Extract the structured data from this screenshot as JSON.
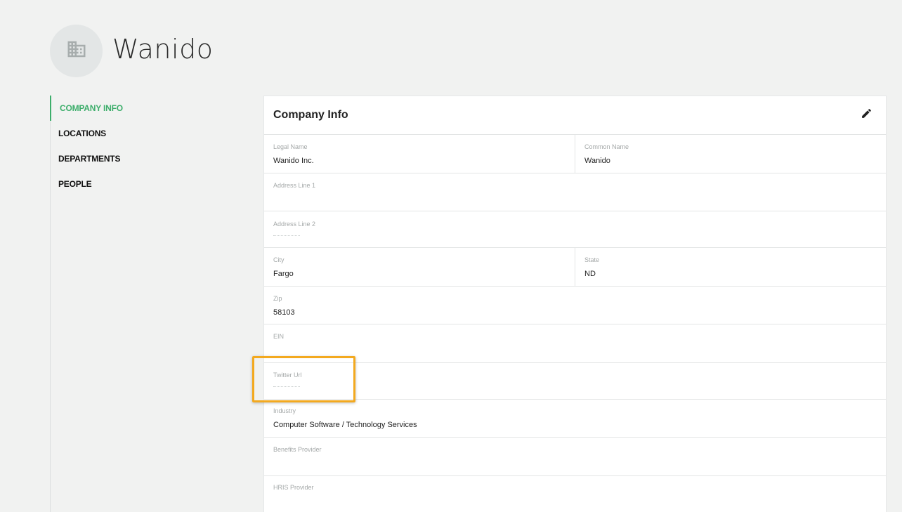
{
  "company": {
    "name": "Wanido",
    "avatar_icon": "building-icon"
  },
  "nav": {
    "items": [
      {
        "label": "COMPANY INFO",
        "active": true
      },
      {
        "label": "LOCATIONS",
        "active": false
      },
      {
        "label": "DEPARTMENTS",
        "active": false
      },
      {
        "label": "PEOPLE",
        "active": false
      }
    ]
  },
  "card": {
    "title": "Company Info",
    "edit_icon": "pencil-icon",
    "fields": {
      "legal_name": {
        "label": "Legal Name",
        "value": "Wanido Inc."
      },
      "common_name": {
        "label": "Common Name",
        "value": "Wanido"
      },
      "address1": {
        "label": "Address Line 1",
        "value": ""
      },
      "address2": {
        "label": "Address Line 2",
        "value": ""
      },
      "city": {
        "label": "City",
        "value": "Fargo"
      },
      "state": {
        "label": "State",
        "value": "ND"
      },
      "zip": {
        "label": "Zip",
        "value": "58103"
      },
      "ein": {
        "label": "EIN",
        "value": ""
      },
      "twitter": {
        "label": "Twitter Url",
        "value": ""
      },
      "industry": {
        "label": "Industry",
        "value": "Computer Software / Technology Services"
      },
      "benefits": {
        "label": "Benefits Provider",
        "value": ""
      },
      "hris": {
        "label": "HRIS Provider",
        "value": ""
      }
    }
  },
  "colors": {
    "accent": "#3dae6b",
    "highlight": "#f3a91f",
    "background": "#f1f2f1"
  }
}
